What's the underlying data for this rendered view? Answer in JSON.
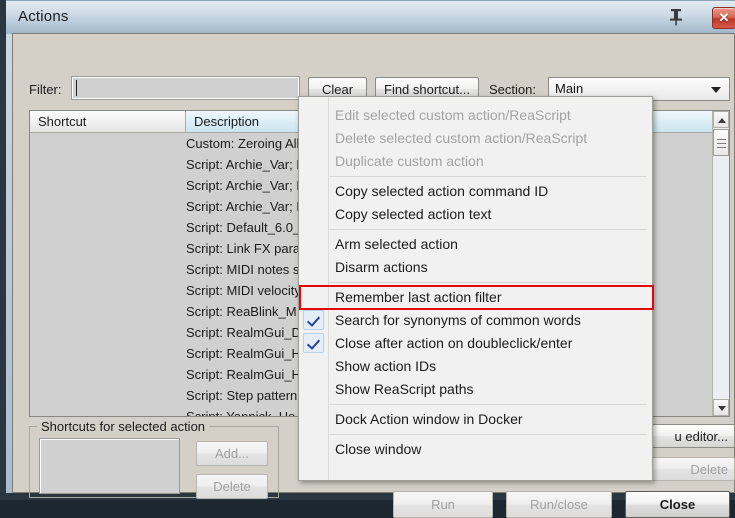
{
  "window": {
    "title": "Actions",
    "pin_icon": "pin-icon",
    "close_icon": "✕"
  },
  "toolbar": {
    "filter_label": "Filter:",
    "filter_value": "",
    "filter_placeholder": "",
    "clear_label": "Clear",
    "find_shortcut_label": "Find shortcut...",
    "section_label": "Section:",
    "section_value": "Main"
  },
  "list": {
    "columns": [
      "Shortcut",
      "Description"
    ],
    "rows": [
      {
        "shortcut": "",
        "description": "Custom: Zeroing All"
      },
      {
        "shortcut": "",
        "description": "Script: Archie_Var; I"
      },
      {
        "shortcut": "",
        "description": "Script: Archie_Var; I"
      },
      {
        "shortcut": "",
        "description": "Script: Archie_Var; I"
      },
      {
        "shortcut": "",
        "description": "Script: Default_6.0_"
      },
      {
        "shortcut": "",
        "description": "Script: Link FX para"
      },
      {
        "shortcut": "",
        "description": "Script: MIDI notes s"
      },
      {
        "shortcut": "",
        "description": "Script: MIDI velocity"
      },
      {
        "shortcut": "",
        "description": "Script: ReaBlink_M"
      },
      {
        "shortcut": "",
        "description": "Script: RealmGui_D"
      },
      {
        "shortcut": "",
        "description": "Script: RealmGui_H"
      },
      {
        "shortcut": "",
        "description": "Script: RealmGui_H"
      },
      {
        "shortcut": "",
        "description": "Script: Step pattern."
      },
      {
        "shortcut": "",
        "description": "Script: Yannick_Ho"
      }
    ],
    "scrollbar": {
      "up_icon": "caret-up-icon",
      "down_icon": "caret-down-icon",
      "thumb_icon": "scroll-thumb-grip"
    }
  },
  "shortcuts_group": {
    "legend": "Shortcuts for selected action",
    "add_label": "Add...",
    "delete_label": "Delete"
  },
  "side_buttons": {
    "menu_editor_label": "u editor...",
    "delete_label": "Delete"
  },
  "footer": {
    "run_label": "Run",
    "run_close_label": "Run/close",
    "close_label": "Close"
  },
  "context_menu": {
    "items": [
      {
        "label": "Edit selected custom action/ReaScript",
        "disabled": true,
        "checked": false
      },
      {
        "label": "Delete selected custom action/ReaScript",
        "disabled": true,
        "checked": false
      },
      {
        "label": "Duplicate custom action",
        "disabled": true,
        "checked": false
      },
      {
        "label": "Copy selected action command ID",
        "disabled": false,
        "checked": false
      },
      {
        "label": "Copy selected action text",
        "disabled": false,
        "checked": false
      },
      {
        "label": "Arm selected action",
        "disabled": false,
        "checked": false
      },
      {
        "label": "Disarm actions",
        "disabled": false,
        "checked": false
      },
      {
        "label": "Remember last action filter",
        "disabled": false,
        "checked": false
      },
      {
        "label": "Search for synonyms of common words",
        "disabled": false,
        "checked": true
      },
      {
        "label": "Close after action on doubleclick/enter",
        "disabled": false,
        "checked": true
      },
      {
        "label": "Show action IDs",
        "disabled": false,
        "checked": false
      },
      {
        "label": "Show ReaScript paths",
        "disabled": false,
        "checked": false
      },
      {
        "label": "Dock Action window in Docker",
        "disabled": false,
        "checked": false
      },
      {
        "label": "Close window",
        "disabled": false,
        "checked": false
      }
    ],
    "highlighted_item_index": 7,
    "highlight_color": "#e10a0a",
    "checkmark_color": "#2b3fa0"
  }
}
